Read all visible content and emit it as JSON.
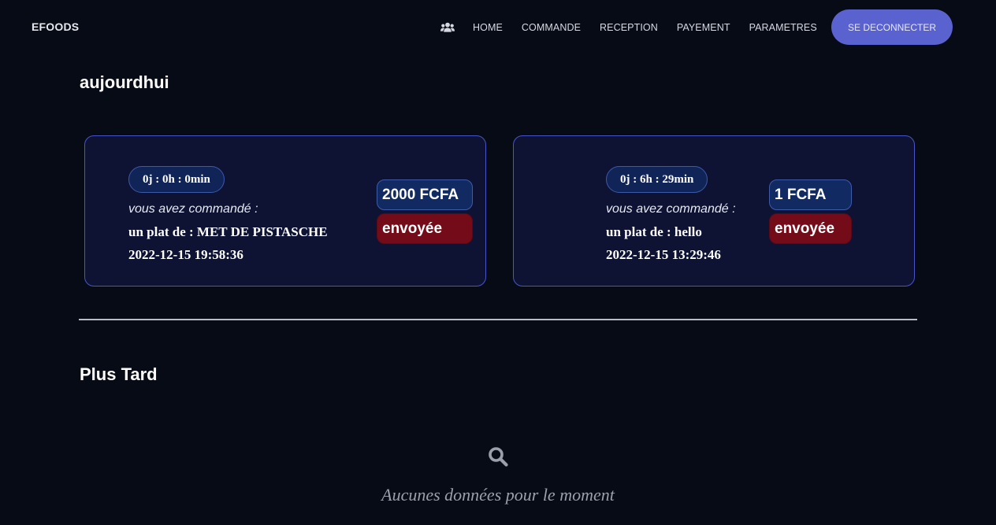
{
  "navbar": {
    "brand": "EFOODS",
    "users_icon": "users-icon",
    "links": [
      "HOME",
      "COMMANDE",
      "RECEPTION",
      "PAYEMENT",
      "PARAMETRES"
    ],
    "logout_label": "SE DECONNECTER"
  },
  "today": {
    "title": "aujourdhui",
    "orders": [
      {
        "timer": "0j : 0h : 0min",
        "intro": "vous avez commandé :",
        "dish": "un plat de : MET DE PISTASCHE",
        "date": "2022-12-15 19:58:36",
        "price": "2000 FCFA",
        "status": "envoyée"
      },
      {
        "timer": "0j : 6h : 29min",
        "intro": "vous avez commandé :",
        "dish": "un plat de : hello",
        "date": "2022-12-15 13:29:46",
        "price": "1 FCFA",
        "status": "envoyée"
      }
    ]
  },
  "later": {
    "title": "Plus Tard",
    "empty_icon": "search-icon",
    "empty_message": "Aucunes données pour le moment"
  },
  "colors": {
    "background": "#070b16",
    "accent": "#5a62cf",
    "card_border": "#4856c9",
    "card_background": "#0e1334",
    "price_badge": "#112a62",
    "status_badge": "#740b19"
  }
}
